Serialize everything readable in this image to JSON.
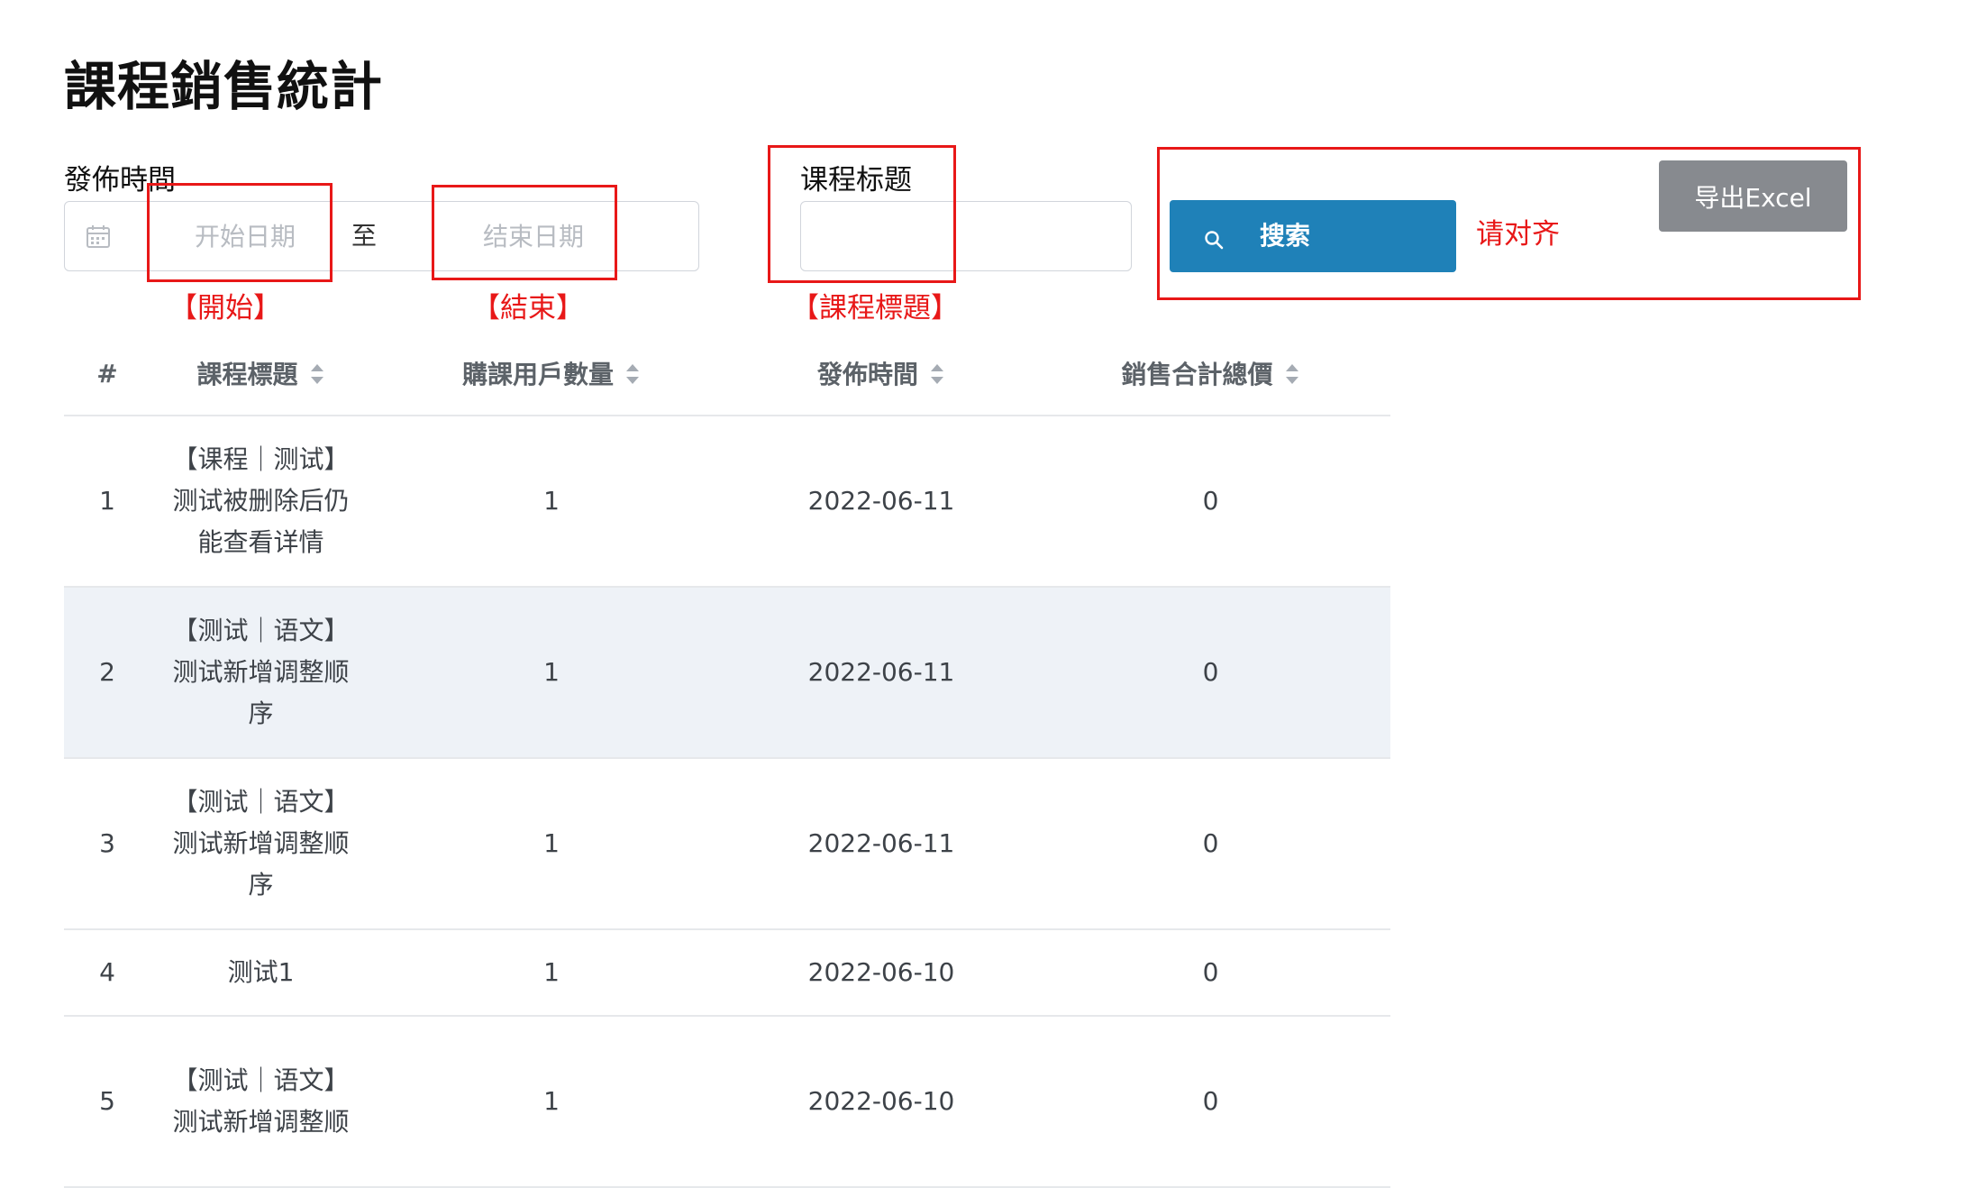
{
  "page": {
    "title": "課程銷售統計"
  },
  "filters": {
    "publish_time_label": "發佈時間",
    "start_placeholder": "开始日期",
    "range_separator": "至",
    "end_placeholder": "结束日期",
    "course_title_label": "课程标题",
    "course_title_value": "",
    "search_button_label": "搜索",
    "export_button_label": "导出Excel"
  },
  "annotations": {
    "start_note": "【開始】",
    "end_note": "【結束】",
    "title_note": "【課程標題】",
    "align_note": "请对齐",
    "color": "#e81818"
  },
  "table": {
    "columns": [
      {
        "label": "#",
        "sortable": false
      },
      {
        "label": "課程標題",
        "sortable": true
      },
      {
        "label": "購課用戶數量",
        "sortable": true
      },
      {
        "label": "發佈時間",
        "sortable": true
      },
      {
        "label": "銷售合計總價",
        "sortable": true
      }
    ],
    "rows": [
      {
        "index": "1",
        "title": "【课程｜测试】测试被删除后仍能查看详情",
        "buyers": "1",
        "publish_date": "2022-06-11",
        "total": "0"
      },
      {
        "index": "2",
        "title": "【测试｜语文】测试新增调整顺序",
        "buyers": "1",
        "publish_date": "2022-06-11",
        "total": "0"
      },
      {
        "index": "3",
        "title": "【测试｜语文】测试新增调整顺序",
        "buyers": "1",
        "publish_date": "2022-06-11",
        "total": "0"
      },
      {
        "index": "4",
        "title": "测试1",
        "buyers": "1",
        "publish_date": "2022-06-10",
        "total": "0"
      },
      {
        "index": "5",
        "title": "【测试｜语文】测试新增调整顺",
        "buyers": "1",
        "publish_date": "2022-06-10",
        "total": "0"
      }
    ]
  },
  "colors": {
    "primary": "#1f81b8",
    "secondary": "#878a8f",
    "row_stripe": "#eef2f7"
  }
}
